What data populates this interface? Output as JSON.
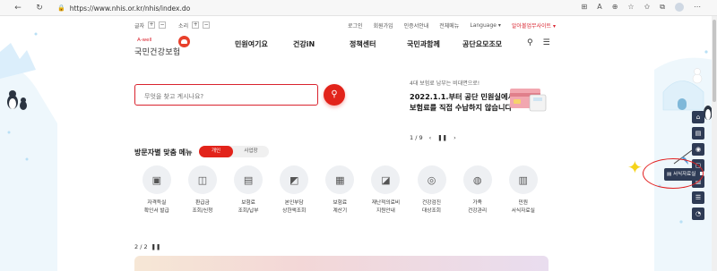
{
  "browser": {
    "url": "https://www.nhis.or.kr/nhis/index.do",
    "icons": [
      "extension-icon",
      "read-aloud-icon",
      "zoom-icon",
      "favorite-icon",
      "favorites-icon",
      "collections-icon",
      "profile-icon",
      "more-icon"
    ]
  },
  "utility": {
    "font_label": "글자",
    "zoom_label": "소리",
    "plus": "+",
    "minus": "−",
    "links": [
      "로그인",
      "회원가입",
      "인증서안내",
      "전체메뉴",
      "Language"
    ],
    "sitemap_link": "알아볼업무사이트"
  },
  "logo": {
    "tagline": "A-well",
    "name": "국민건강보험"
  },
  "gnb": [
    "민원여기요",
    "건강iN",
    "정책센터",
    "국민과함께",
    "공단요모조모"
  ],
  "search": {
    "placeholder": "무엇을 찾고 계시나요?"
  },
  "promo": {
    "small": "4대 보험료 납부는 비대면으로!",
    "line1": "2022.1.1.부터 공단 민원실에서",
    "line2": "보험료를 직접 수납하지 않습니다"
  },
  "pager": {
    "counter": "1 / 9",
    "prev": "‹",
    "pause": "❚❚",
    "next": "›"
  },
  "menu": {
    "title": "방문자별 맞춤 메뉴",
    "toggle_on": "개인",
    "toggle_off": "사업장"
  },
  "services": [
    {
      "icon": "certificate-icon",
      "glyph": "▣",
      "label": "자격득실\n확인서 발급"
    },
    {
      "icon": "refund-icon",
      "glyph": "◫",
      "label": "환급금\n조회/신청"
    },
    {
      "icon": "premium-icon",
      "glyph": "▤",
      "label": "보험료\n조회/납부"
    },
    {
      "icon": "copay-icon",
      "glyph": "◩",
      "label": "본인부담\n상한액조회"
    },
    {
      "icon": "calculator-icon",
      "glyph": "▦",
      "label": "보험료\n계산기"
    },
    {
      "icon": "disaster-support-icon",
      "glyph": "◪",
      "label": "재난적의료비\n지원안내"
    },
    {
      "icon": "checkup-icon",
      "glyph": "◎",
      "label": "건강검진\n대상조회"
    },
    {
      "icon": "family-health-icon",
      "glyph": "◍",
      "label": "가족\n건강관리"
    },
    {
      "icon": "forms-icon",
      "glyph": "▥",
      "label": "민원\n서식자료실"
    }
  ],
  "bottom_pager": {
    "counter": "2 / 2",
    "pause": "❚❚"
  },
  "quick_menu": {
    "popup_label": "서식자료실"
  },
  "colors": {
    "brand_red": "#e2231a",
    "quick_navy": "#2e3b55"
  }
}
